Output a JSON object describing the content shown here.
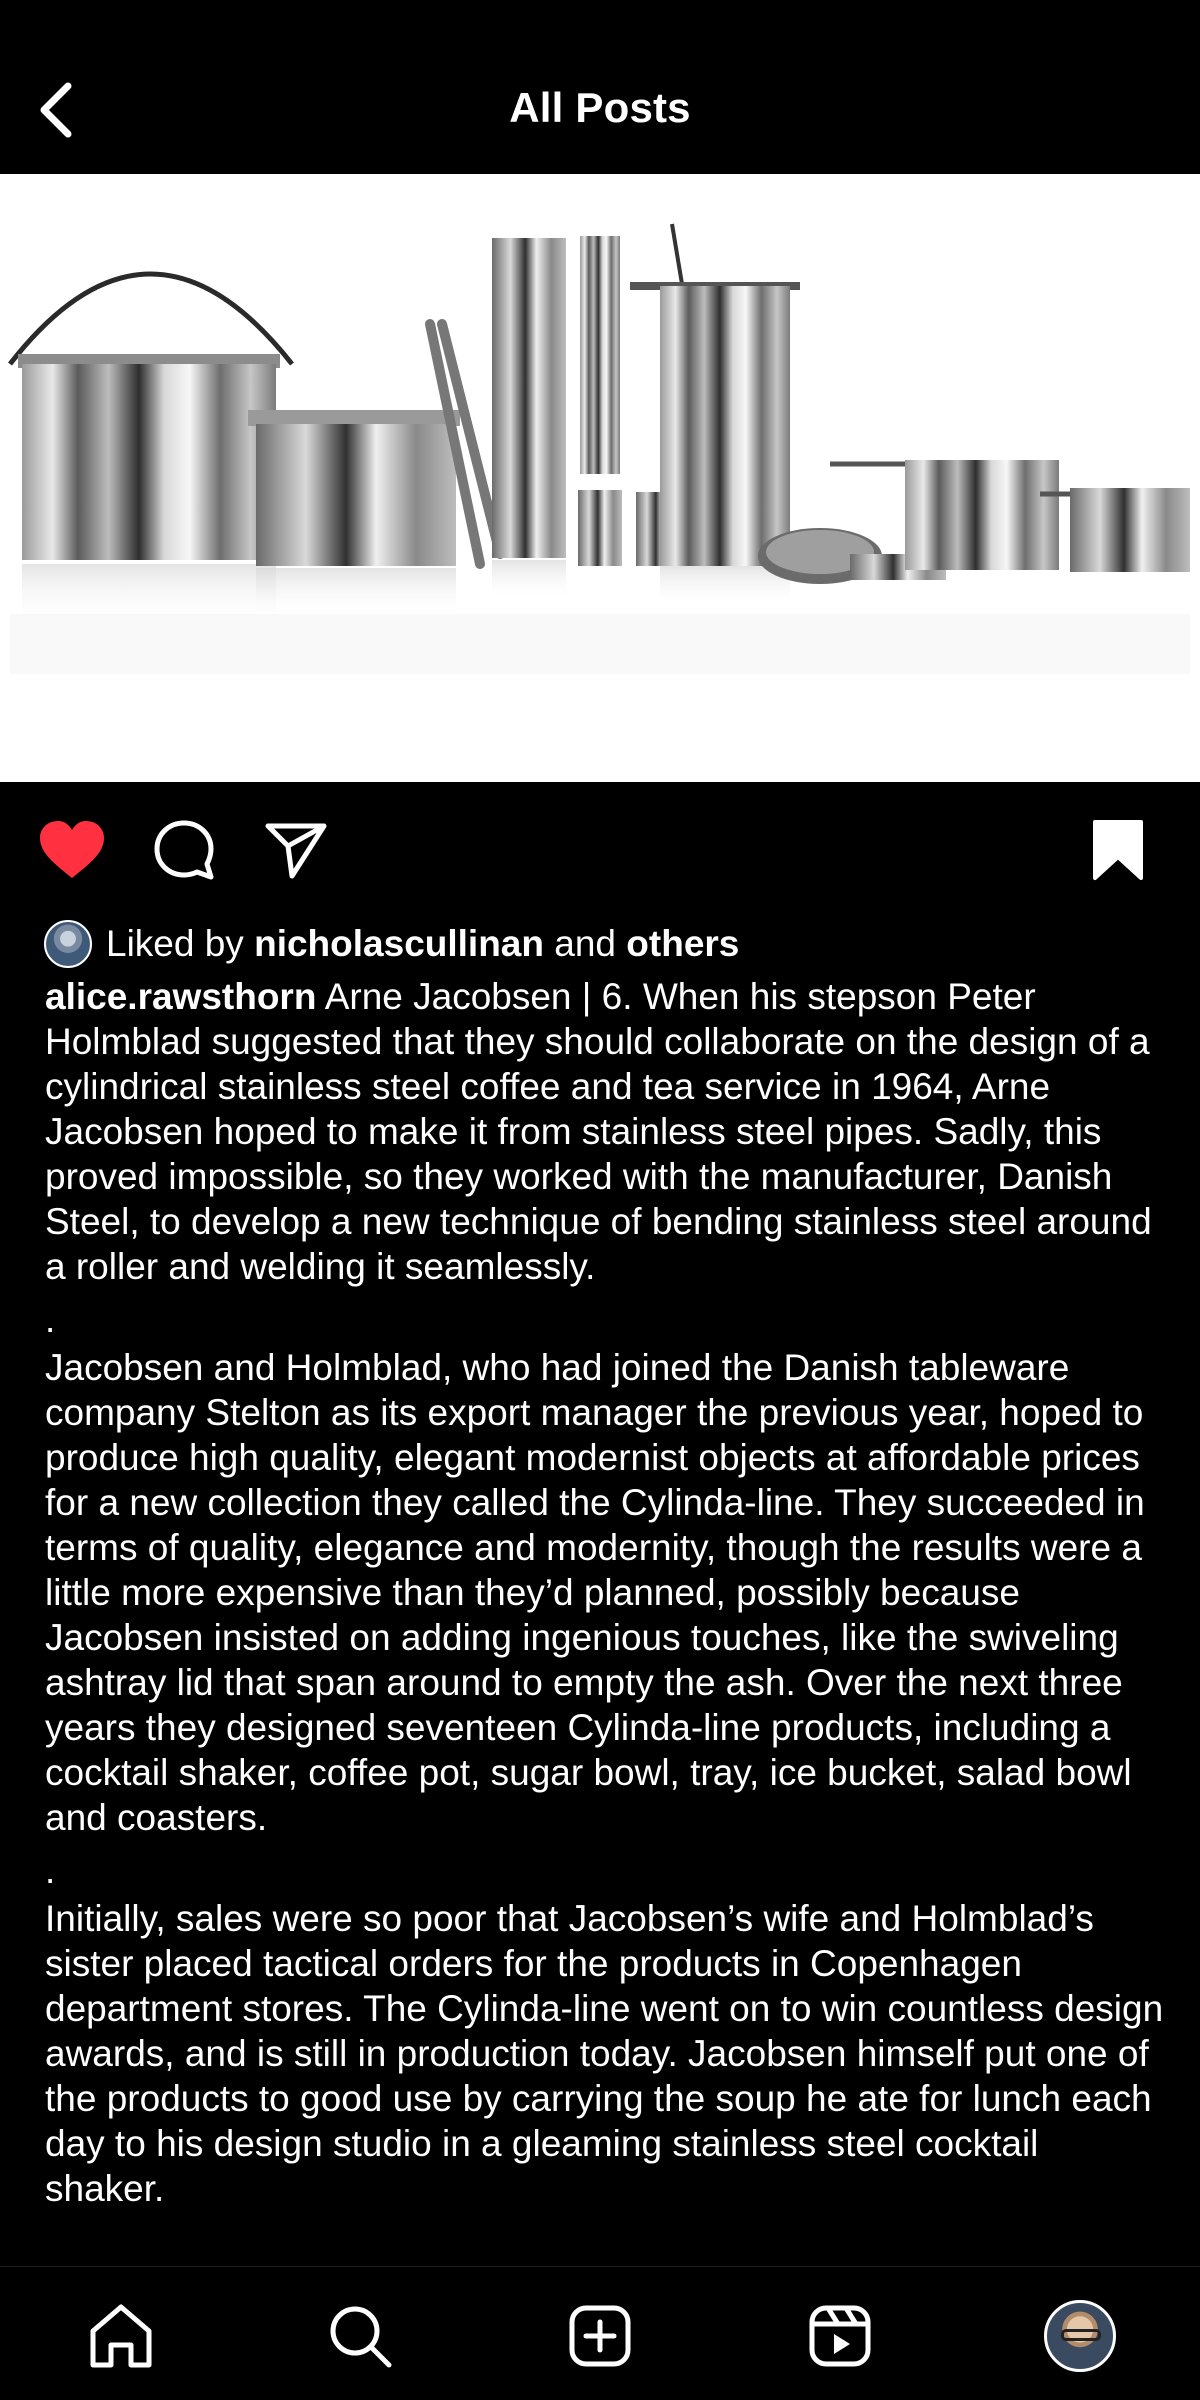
{
  "header": {
    "title": "All Posts"
  },
  "post": {
    "image_icon": "stainless-steel-cylinda-line-products",
    "liked": true,
    "saved": true,
    "likes": {
      "prefix": "Liked by",
      "user": "nicholascullinan",
      "joiner": "and",
      "others": "others"
    },
    "caption": {
      "username": "alice.rawsthorn",
      "paragraphs": [
        "Arne Jacobsen | 6. When his stepson Peter Holmblad suggested that they should collaborate on the design of a cylindrical stainless steel coffee and tea service in 1964, Arne Jacobsen hoped to make it from stainless steel pipes. Sadly, this proved impossible, so they worked with the manufacturer, Danish Steel, to develop a new technique of bending stainless steel around a roller and welding it seamlessly.",
        ".",
        "Jacobsen and Holmblad, who had joined the Danish tableware company Stelton as its export manager the previous year, hoped to produce high quality, elegant modernist objects at affordable prices for a new collection they called the Cylinda-line.  They succeeded in terms of quality, elegance and modernity, though the results were a little more expensive than they’d planned, possibly because Jacobsen insisted on adding ingenious touches, like the swiveling ashtray lid that span around to empty the ash. Over the next three years they designed seventeen Cylinda-line products, including a cocktail shaker, coffee pot, sugar bowl, tray, ice bucket, salad bowl and coasters.",
        ".",
        "Initially, sales were so poor that Jacobsen’s wife and Holmblad’s sister placed tactical orders for the products in Copenhagen department stores. The Cylinda-line went on to win countless design awards, and is still in production today. Jacobsen himself put one of the products to good use by carrying the soup he ate for lunch each day to his design studio in a gleaming stainless steel cocktail shaker."
      ]
    }
  },
  "colors": {
    "background": "#000000",
    "text": "#ffffff",
    "like": "#ff3040",
    "image_bg": "#ffffff"
  },
  "icons": {
    "back": "chevron-left-icon",
    "like": "heart-filled-icon",
    "comment": "comment-bubble-icon",
    "share": "paper-plane-icon",
    "save": "bookmark-filled-icon",
    "home": "home-icon",
    "search": "search-icon",
    "create": "plus-square-icon",
    "reels": "reels-icon",
    "profile": "profile-avatar"
  }
}
